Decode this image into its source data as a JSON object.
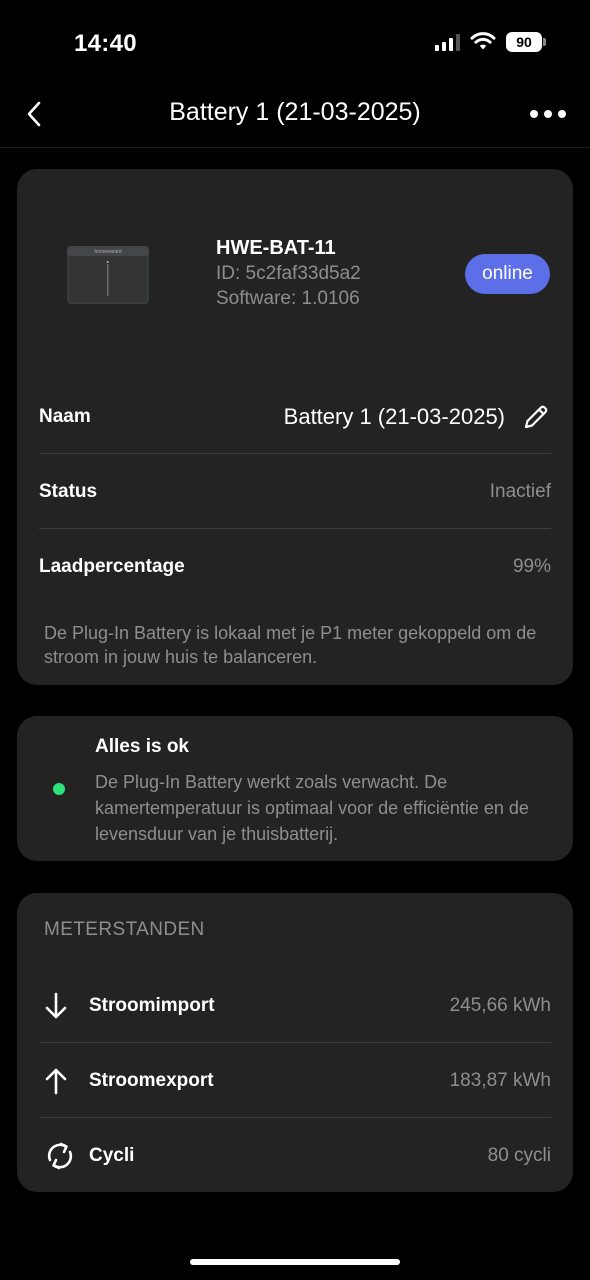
{
  "status_bar": {
    "time": "14:40",
    "battery_level": "90"
  },
  "nav": {
    "title": "Battery 1 (21-03-2025)"
  },
  "device": {
    "model": "HWE-BAT-11",
    "id": "ID: 5c2faf33d5a2",
    "software": "Software: 1.0106",
    "status_badge": "online",
    "image_brand": "homewizard"
  },
  "details": [
    {
      "label": "Naam",
      "value": "Battery 1 (21-03-2025)"
    },
    {
      "label": "Status",
      "value": "Inactief"
    },
    {
      "label": "Laadpercentage",
      "value": "99%"
    }
  ],
  "description": "De Plug-In Battery is lokaal met je P1 meter gekoppeld om de stroom in jouw huis te balanceren.",
  "alert": {
    "title": "Alles is ok",
    "text": "De Plug-In Battery werkt zoals verwacht. De kamertemperatuur is optimaal voor de efficiëntie en de levensduur van je thuisbatterij."
  },
  "meters": {
    "heading": "METERSTANDEN",
    "rows": [
      {
        "icon": "arrow-down-icon",
        "label": "Stroomimport",
        "value": "245,66 kWh"
      },
      {
        "icon": "arrow-up-icon",
        "label": "Stroomexport",
        "value": "183,87 kWh"
      },
      {
        "icon": "cycle-icon",
        "label": "Cycli",
        "value": "80 cycli"
      }
    ]
  },
  "colors": {
    "background": "#000000",
    "card": "#232323",
    "accent": "#5c6ee8",
    "ok": "#2ee07a",
    "muted_text": "#8e8e8e"
  }
}
